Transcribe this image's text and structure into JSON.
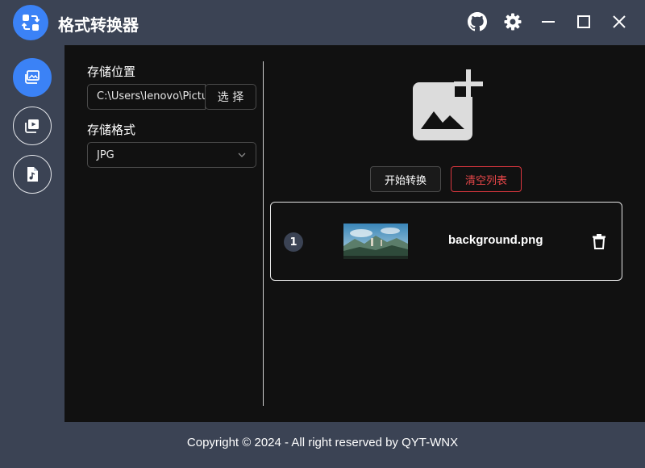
{
  "app": {
    "title": "格式转换器"
  },
  "titlebar": {
    "icons": [
      "github-icon",
      "settings-gear-icon",
      "minimize-icon",
      "maximize-icon",
      "close-icon"
    ]
  },
  "sidebar": {
    "items": [
      {
        "icon": "image-convert-icon",
        "active": true
      },
      {
        "icon": "video-convert-icon",
        "active": false
      },
      {
        "icon": "audio-file-icon",
        "active": false
      }
    ]
  },
  "settings": {
    "save_location_label": "存储位置",
    "save_path_value": "C:\\Users\\lenovo\\Pictures",
    "choose_button": "选 择",
    "save_format_label": "存储格式",
    "format_value": "JPG"
  },
  "actions": {
    "start_button": "开始转换",
    "clear_button": "清空列表"
  },
  "files": [
    {
      "index": "1",
      "name": "background.png"
    }
  ],
  "footer": {
    "text": "Copyright © 2024 - All right reserved by QYT-WNX"
  },
  "colors": {
    "accent": "#3b82f6",
    "danger": "#e84749",
    "chrome": "#3b4354",
    "panel": "#111111"
  }
}
